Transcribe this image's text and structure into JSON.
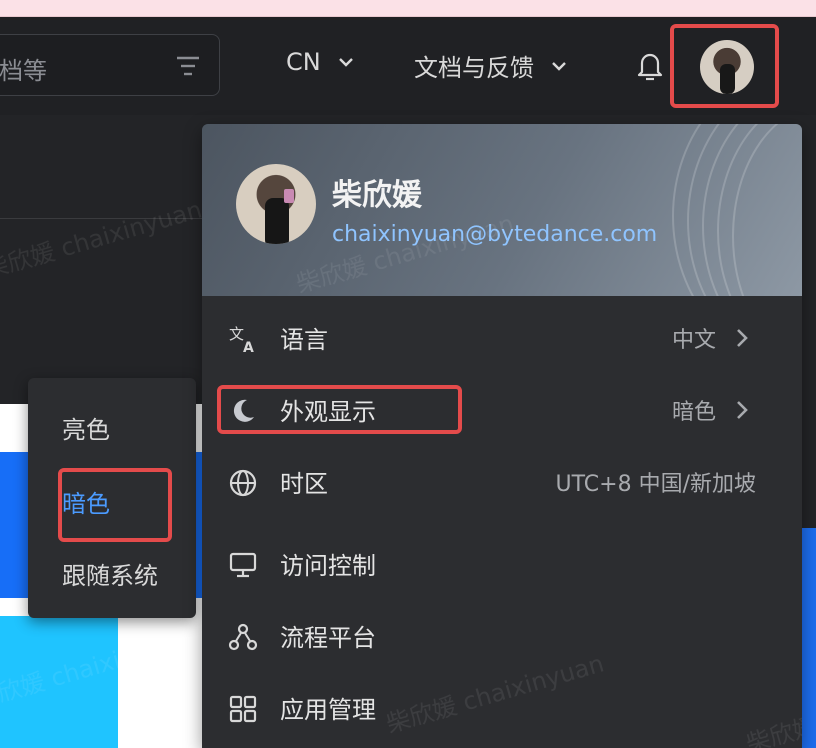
{
  "header": {
    "search_placeholder": "档等",
    "language": "CN",
    "docs_feedback": "文档与反馈"
  },
  "profile": {
    "name": "柴欣媛",
    "email": "chaixinyuan@bytedance.com"
  },
  "menu": {
    "items": [
      {
        "label": "语言",
        "value": "中文",
        "icon": "translate-icon"
      },
      {
        "label": "外观显示",
        "value": "暗色",
        "icon": "moon-icon"
      },
      {
        "label": "时区",
        "value": "UTC+8 中国/新加坡",
        "icon": "globe-icon"
      },
      {
        "label": "访问控制",
        "value": "",
        "icon": "monitor-icon"
      },
      {
        "label": "流程平台",
        "value": "",
        "icon": "workflow-icon"
      },
      {
        "label": "应用管理",
        "value": "",
        "icon": "apps-grid-icon"
      }
    ]
  },
  "appearance_submenu": {
    "options": [
      "亮色",
      "暗色",
      "跟随系统"
    ],
    "selected": "暗色"
  },
  "watermark": "柴欣媛 chaixinyuan",
  "colors": {
    "accent": "#4b9bff",
    "highlight_box": "#e44b4b",
    "background": "#232427",
    "menu_bg": "#2c2d30"
  }
}
